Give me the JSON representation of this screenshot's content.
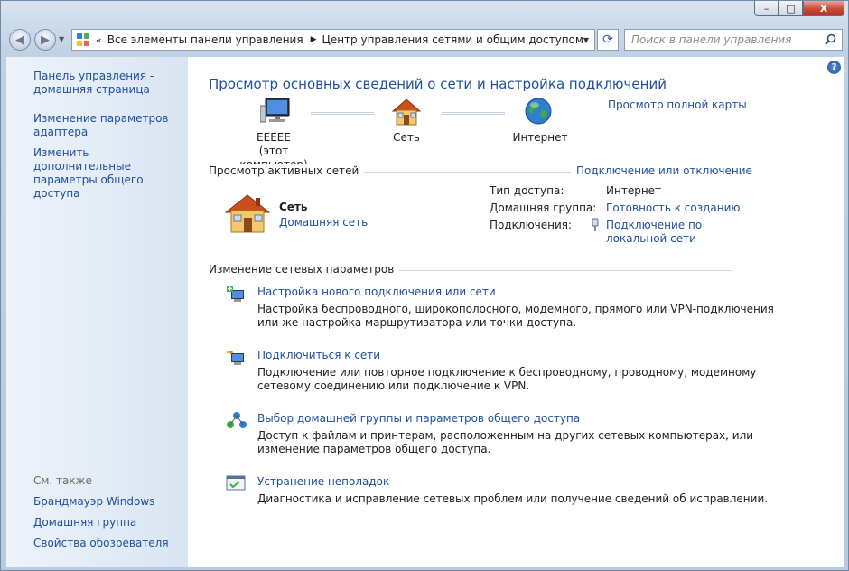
{
  "window": {
    "caption_buttons": {
      "minimize": "–",
      "maximize": "□",
      "close": "X"
    }
  },
  "toolbar": {
    "back_icon": "back-arrow-icon",
    "forward_icon": "forward-arrow-icon",
    "breadcrumb_prefix": "«",
    "breadcrumb": [
      "Все элементы панели управления",
      "Центр управления сетями и общим доступом"
    ],
    "breadcrumb_separator": "▶",
    "search_placeholder": "Поиск в панели управления"
  },
  "sidebar": {
    "items": [
      {
        "label_line1": "Панель управления -",
        "label_line2": "домашняя страница"
      },
      {
        "label_line1": "Изменение параметров",
        "label_line2": "адаптера"
      },
      {
        "label_line1": "Изменить дополнительные",
        "label_line2": "параметры общего доступа"
      }
    ],
    "see_also": "См. также",
    "see_also_items": [
      "Брандмауэр Windows",
      "Домашняя группа",
      "Свойства обозревателя"
    ]
  },
  "main": {
    "title": "Просмотр основных сведений о сети и настройка подключений",
    "full_map_link": "Просмотр полной карты",
    "map": {
      "computer_name": "EEEEE",
      "computer_sub": "(этот компьютер)",
      "network": "Сеть",
      "internet": "Интернет"
    },
    "active_networks": {
      "title": "Просмотр активных сетей",
      "connect_link": "Подключение или отключение",
      "network_name": "Сеть",
      "network_type": "Домашняя сеть",
      "access_type_label": "Тип доступа:",
      "access_type_value": "Интернет",
      "homegroup_label": "Домашняя группа:",
      "homegroup_value": "Готовность к созданию",
      "connections_label": "Подключения:",
      "connection_line1": "Подключение по",
      "connection_line2": "локальной сети"
    },
    "change_settings": {
      "title": "Изменение сетевых параметров",
      "tasks": [
        {
          "link": "Настройка нового подключения или сети",
          "desc1": "Настройка беспроводного, широкополосного, модемного, прямого или VPN-подключения",
          "desc2": "или же настройка маршрутизатора или точки доступа."
        },
        {
          "link": "Подключиться к сети",
          "desc1": "Подключение или повторное подключение к беспроводному, проводному, модемному",
          "desc2": "сетевому соединению или подключение к VPN."
        },
        {
          "link": "Выбор домашней группы и параметров общего доступа",
          "desc1": "Доступ к файлам и принтерам, расположенным на других сетевых компьютерах, или",
          "desc2": "изменение параметров общего доступа."
        },
        {
          "link": "Устранение неполадок",
          "desc1": "Диагностика и исправление сетевых проблем или получение сведений об исправлении.",
          "desc2": ""
        }
      ]
    }
  }
}
